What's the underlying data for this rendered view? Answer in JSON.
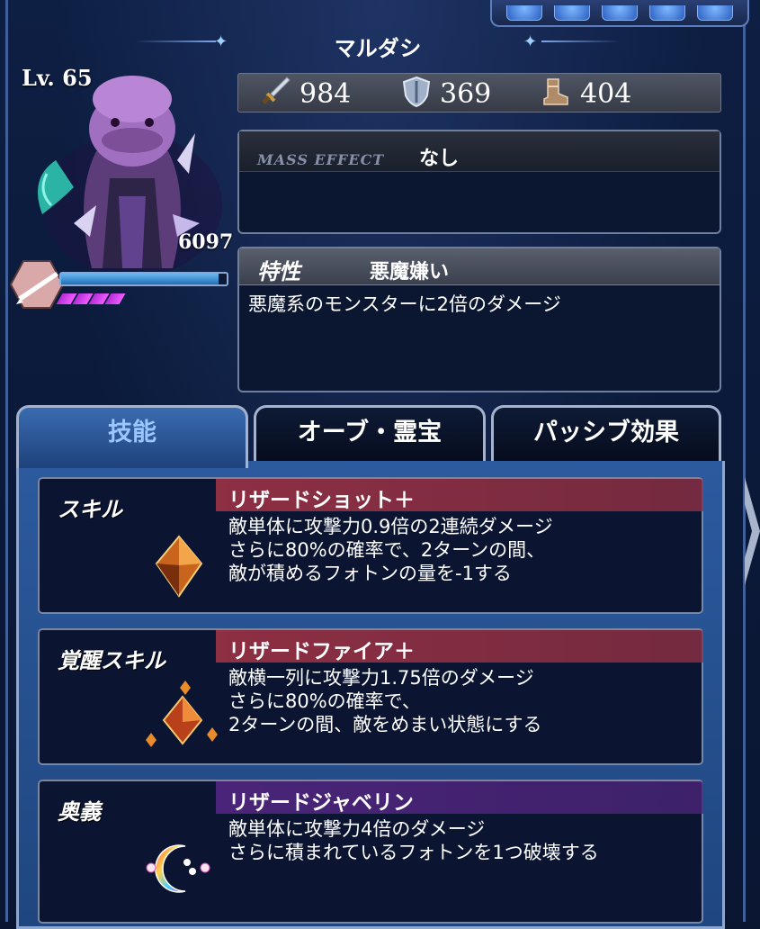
{
  "character": {
    "name": "マルダシ",
    "level": "Lv. 65",
    "hp": "6097",
    "hp_fraction": 0.95,
    "pips": 4
  },
  "stats": {
    "attack": "984",
    "defense": "369",
    "speed": "404"
  },
  "mass_effect": {
    "label": "MASS EFFECT",
    "value": "なし"
  },
  "trait": {
    "label": "特性",
    "name": "悪魔嫌い",
    "description": "悪魔系のモンスターに2倍のダメージ"
  },
  "tabs": [
    {
      "label": "技能"
    },
    {
      "label": "オーブ・霊宝"
    },
    {
      "label": "パッシブ効果"
    }
  ],
  "skills": [
    {
      "type": "スキル",
      "name": "リザードショット＋",
      "lines": [
        "敵単体に攻撃力0.9倍の2連続ダメージ",
        "さらに80%の確率で、2ターンの間、",
        "敵が積めるフォトンの量を-1する"
      ],
      "header_color": "#8e2f43",
      "icon": "orange-crystal-icon"
    },
    {
      "type": "覚醒スキル",
      "name": "リザードファイア＋",
      "lines": [
        "敵横一列に攻撃力1.75倍のダメージ",
        "さらに80%の確率で、",
        "2ターンの間、敵をめまい状態にする"
      ],
      "header_color": "#8e2f43",
      "icon": "awakened-crystal-icon"
    },
    {
      "type": "奥義",
      "name": "リザードジャベリン",
      "lines": [
        "敵単体に攻撃力4倍のダメージ",
        "さらに積まれているフォトンを1つ破壊する"
      ],
      "header_color": "#4a2478",
      "icon": "rainbow-moon-icon"
    }
  ]
}
